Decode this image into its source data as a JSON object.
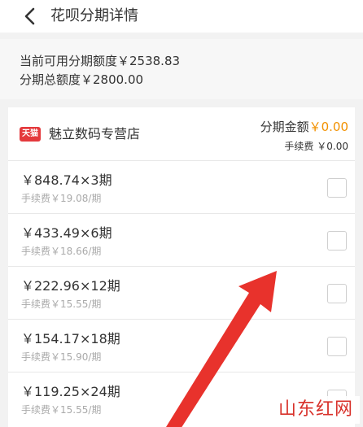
{
  "header": {
    "title": "花呗分期详情",
    "back_icon": "chevron-left-icon"
  },
  "quota": {
    "available_line": "当前可用分期额度￥2538.83",
    "total_line": "分期总额度￥2800.00"
  },
  "store": {
    "badge": "天猫",
    "name": "魅立数码专营店",
    "amount_label": "分期金额",
    "amount_value": "￥0.00",
    "fee_label": "手续费",
    "fee_value": "￥0.00"
  },
  "plans": [
    {
      "main": "￥848.74×3期",
      "fee": "手续费￥19.08/期",
      "checked": false
    },
    {
      "main": "￥433.49×6期",
      "fee": "手续费￥18.66/期",
      "checked": false
    },
    {
      "main": "￥222.96×12期",
      "fee": "手续费￥15.55/期",
      "checked": false
    },
    {
      "main": "￥154.17×18期",
      "fee": "手续费￥15.90/期",
      "checked": false
    },
    {
      "main": "￥119.25×24期",
      "fee": "手续费￥15.55/期",
      "checked": false
    }
  ],
  "watermark": "山东红网",
  "colors": {
    "accent_orange": "#f29100",
    "tmall_red": "#e4393c",
    "arrow_red": "#e8322c",
    "watermark_red": "#d8322b"
  }
}
